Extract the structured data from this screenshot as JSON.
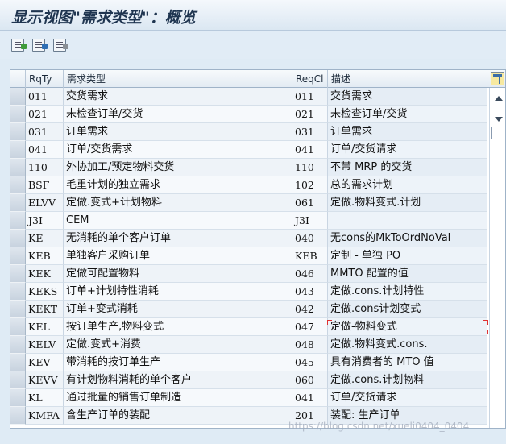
{
  "window": {
    "title": "显示视图\"需求类型\"：概览"
  },
  "toolbar": {
    "buttons": [
      "detail-view-icon",
      "save-icon",
      "print-icon"
    ]
  },
  "table": {
    "columns": [
      "RqTy",
      "需求类型",
      "ReqCl",
      "描述"
    ],
    "rows": [
      [
        "011",
        "交货需求",
        "011",
        "交货需求"
      ],
      [
        "021",
        "未检查订单/交货",
        "021",
        "未检查订单/交货"
      ],
      [
        "031",
        "订单需求",
        "031",
        "订单需求"
      ],
      [
        "041",
        "订单/交货需求",
        "041",
        "订单/交货请求"
      ],
      [
        "110",
        "外协加工/预定物料交货",
        "110",
        "不带 MRP 的交货"
      ],
      [
        "BSF",
        "毛重计划的独立需求",
        "102",
        "总的需求计划"
      ],
      [
        "ELVV",
        "定做.变式+计划物料",
        "061",
        "定做.物料变式.计划"
      ],
      [
        "J3I",
        "CEM",
        "J3I",
        ""
      ],
      [
        "KE",
        "无消耗的单个客户订单",
        "040",
        "无cons的MkToOrdNoVal"
      ],
      [
        "KEB",
        "单独客户采购订单",
        "KEB",
        "定制 - 单独 PO"
      ],
      [
        "KEK",
        "定做可配置物料",
        "046",
        "MMTO 配置的值"
      ],
      [
        "KEKS",
        "订单+计划特性消耗",
        "043",
        "定做.cons.计划特性"
      ],
      [
        "KEKT",
        "订单+变式消耗",
        "042",
        "定做.cons计划变式"
      ],
      [
        "KEL",
        "按订单生产,物料变式",
        "047",
        "定做-物料变式"
      ],
      [
        "KELV",
        "定做.变式+消费",
        "048",
        "定做.物料变式.cons."
      ],
      [
        "KEV",
        "带消耗的按订单生产",
        "045",
        "具有消费者的 MTO 值"
      ],
      [
        "KEVV",
        "有计划物料消耗的单个客户",
        "060",
        "定做.cons.计划物料"
      ],
      [
        "KL",
        "通过批量的销售订单制造",
        "041",
        "订单/交货请求"
      ],
      [
        "KMFA",
        "含生产订单的装配",
        "201",
        "装配: 生产订单"
      ]
    ]
  },
  "watermark": "https://blog.csdn.net/xueli0404_0404"
}
